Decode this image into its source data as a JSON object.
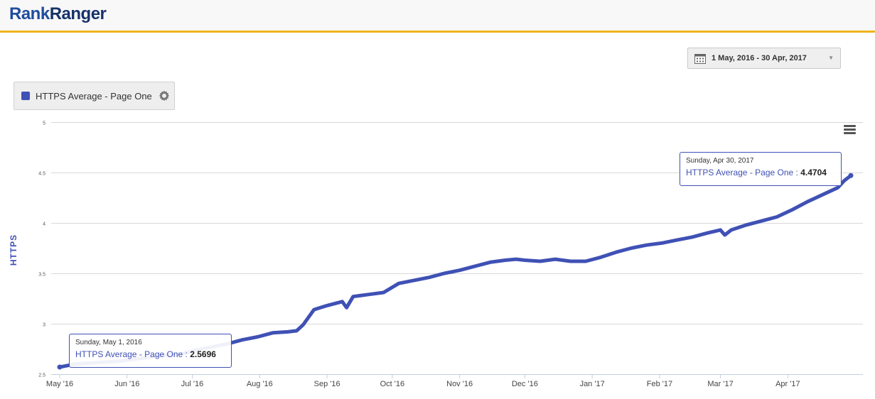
{
  "header": {
    "logo_rank": "Rank",
    "logo_ranger": "Ranger"
  },
  "controls": {
    "date_range": "1 May, 2016 - 30 Apr, 2017",
    "series_chip_label": "HTTPS Average - Page One"
  },
  "colors": {
    "series": "#3f51b5",
    "accent_bar": "#f0b41c",
    "logo_dark": "#17326a",
    "logo_light": "#1f4d9e"
  },
  "icons": {
    "calendar": "calendar-icon",
    "gear": "gear-icon",
    "menu": "hamburger-menu-icon",
    "dropdown": "caret-down-icon"
  },
  "tooltips": [
    {
      "date": "Sunday, May 1, 2016",
      "series": "HTTPS Average - Page One",
      "sep": " : ",
      "value": "2.5696"
    },
    {
      "date": "Sunday, Apr 30, 2017",
      "series": "HTTPS Average - Page One",
      "sep": " : ",
      "value": "4.4704"
    }
  ],
  "chart_data": {
    "type": "line",
    "title": "",
    "ylabel": "HTTPS",
    "xlabel": "",
    "ylim": [
      2.5,
      5
    ],
    "yticks": [
      2.5,
      3,
      3.5,
      4,
      4.5,
      5
    ],
    "ytick_labels": [
      "2.5",
      "3",
      "3.5",
      "4",
      "4.5",
      "5"
    ],
    "xlim": [
      "2016-05-01",
      "2017-04-30"
    ],
    "xtick_labels": [
      {
        "date": "2016-05-01",
        "label": "May '16"
      },
      {
        "date": "2016-06-01",
        "label": "Jun '16"
      },
      {
        "date": "2016-07-01",
        "label": "Jul '16"
      },
      {
        "date": "2016-08-01",
        "label": "Aug '16"
      },
      {
        "date": "2016-09-01",
        "label": "Sep '16"
      },
      {
        "date": "2016-10-01",
        "label": "Oct '16"
      },
      {
        "date": "2016-11-01",
        "label": "Nov '16"
      },
      {
        "date": "2016-12-01",
        "label": "Dec '16"
      },
      {
        "date": "2017-01-01",
        "label": "Jan '17"
      },
      {
        "date": "2017-02-01",
        "label": "Feb '17"
      },
      {
        "date": "2017-03-01",
        "label": "Mar '17"
      },
      {
        "date": "2017-04-01",
        "label": "Apr '17"
      }
    ],
    "grid": true,
    "legend": "top-left",
    "series": [
      {
        "name": "HTTPS Average - Page One",
        "color": "#3f51b5",
        "points": [
          [
            "2016-05-01",
            2.57
          ],
          [
            "2016-05-08",
            2.6
          ],
          [
            "2016-05-15",
            2.61
          ],
          [
            "2016-05-22",
            2.62
          ],
          [
            "2016-05-29",
            2.63
          ],
          [
            "2016-06-05",
            2.65
          ],
          [
            "2016-06-12",
            2.67
          ],
          [
            "2016-06-19",
            2.69
          ],
          [
            "2016-06-26",
            2.7
          ],
          [
            "2016-07-03",
            2.74
          ],
          [
            "2016-07-10",
            2.77
          ],
          [
            "2016-07-17",
            2.8
          ],
          [
            "2016-07-24",
            2.84
          ],
          [
            "2016-07-31",
            2.87
          ],
          [
            "2016-08-07",
            2.91
          ],
          [
            "2016-08-14",
            2.92
          ],
          [
            "2016-08-18",
            2.93
          ],
          [
            "2016-08-21",
            2.99
          ],
          [
            "2016-08-26",
            3.14
          ],
          [
            "2016-09-01",
            3.18
          ],
          [
            "2016-09-08",
            3.22
          ],
          [
            "2016-09-10",
            3.16
          ],
          [
            "2016-09-13",
            3.27
          ],
          [
            "2016-09-20",
            3.29
          ],
          [
            "2016-09-27",
            3.31
          ],
          [
            "2016-10-04",
            3.4
          ],
          [
            "2016-10-11",
            3.43
          ],
          [
            "2016-10-18",
            3.46
          ],
          [
            "2016-10-25",
            3.5
          ],
          [
            "2016-11-01",
            3.53
          ],
          [
            "2016-11-08",
            3.57
          ],
          [
            "2016-11-15",
            3.61
          ],
          [
            "2016-11-22",
            3.63
          ],
          [
            "2016-11-27",
            3.64
          ],
          [
            "2016-12-01",
            3.63
          ],
          [
            "2016-12-08",
            3.62
          ],
          [
            "2016-12-15",
            3.64
          ],
          [
            "2016-12-22",
            3.62
          ],
          [
            "2016-12-29",
            3.62
          ],
          [
            "2017-01-05",
            3.66
          ],
          [
            "2017-01-12",
            3.71
          ],
          [
            "2017-01-19",
            3.75
          ],
          [
            "2017-01-26",
            3.78
          ],
          [
            "2017-02-02",
            3.8
          ],
          [
            "2017-02-09",
            3.83
          ],
          [
            "2017-02-16",
            3.86
          ],
          [
            "2017-02-23",
            3.9
          ],
          [
            "2017-03-01",
            3.93
          ],
          [
            "2017-03-03",
            3.88
          ],
          [
            "2017-03-06",
            3.93
          ],
          [
            "2017-03-13",
            3.98
          ],
          [
            "2017-03-20",
            4.02
          ],
          [
            "2017-03-27",
            4.06
          ],
          [
            "2017-04-03",
            4.13
          ],
          [
            "2017-04-10",
            4.21
          ],
          [
            "2017-04-17",
            4.28
          ],
          [
            "2017-04-24",
            4.35
          ],
          [
            "2017-04-27",
            4.42
          ],
          [
            "2017-04-30",
            4.47
          ]
        ]
      }
    ]
  }
}
